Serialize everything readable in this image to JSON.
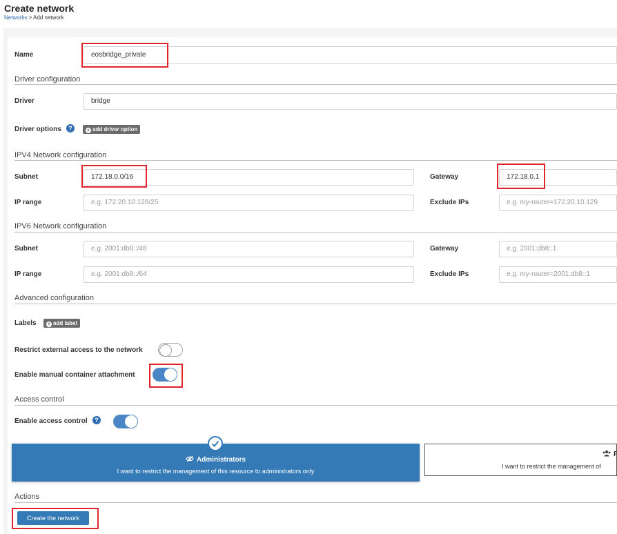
{
  "header": {
    "title": "Create network",
    "breadcrumb_link": "Networks",
    "breadcrumb_sep": " > ",
    "breadcrumb_current": "Add network"
  },
  "form": {
    "name_label": "Name",
    "name_value": "eosbridge_private",
    "driver_section": "Driver configuration",
    "driver_label": "Driver",
    "driver_value": "bridge",
    "driver_options_label": "Driver options",
    "add_driver_option": "add driver option",
    "ipv4_section": "IPV4 Network configuration",
    "ipv4_subnet_label": "Subnet",
    "ipv4_subnet_value": "172.18.0.0/16",
    "ipv4_gateway_label": "Gateway",
    "ipv4_gateway_value": "172.18.0.1",
    "ipv4_iprange_label": "IP range",
    "ipv4_iprange_placeholder": "e.g. 172.20.10.128/25",
    "ipv4_exclude_label": "Exclude IPs",
    "ipv4_exclude_placeholder": "e.g. my-router=172.20.10.129",
    "ipv6_section": "IPV6 Network configuration",
    "ipv6_subnet_label": "Subnet",
    "ipv6_subnet_placeholder": "e.g. 2001:db8::/48",
    "ipv6_gateway_label": "Gateway",
    "ipv6_gateway_placeholder": "e.g. 2001:db8::1",
    "ipv6_iprange_label": "IP range",
    "ipv6_iprange_placeholder": "e.g. 2001:db8::/64",
    "ipv6_exclude_label": "Exclude IPs",
    "ipv6_exclude_placeholder": "e.g. my-router=2001:db8::1",
    "advanced_section": "Advanced configuration",
    "labels_label": "Labels",
    "add_label": "add label",
    "restrict_label": "Restrict external access to the network",
    "restrict_on": false,
    "attach_label": "Enable manual container attachment",
    "attach_on": true
  },
  "access": {
    "section": "Access control",
    "enable_label": "Enable access control",
    "enable_on": true,
    "admin_title": "Administrators",
    "admin_desc": "I want to restrict the management of this resource to administrators only",
    "restricted_title": "R",
    "restricted_desc": "I want to restrict the management of"
  },
  "actions": {
    "section": "Actions",
    "create_button": "Create the network"
  },
  "colors": {
    "primary": "#337ab7",
    "highlight": "#e0242c"
  }
}
